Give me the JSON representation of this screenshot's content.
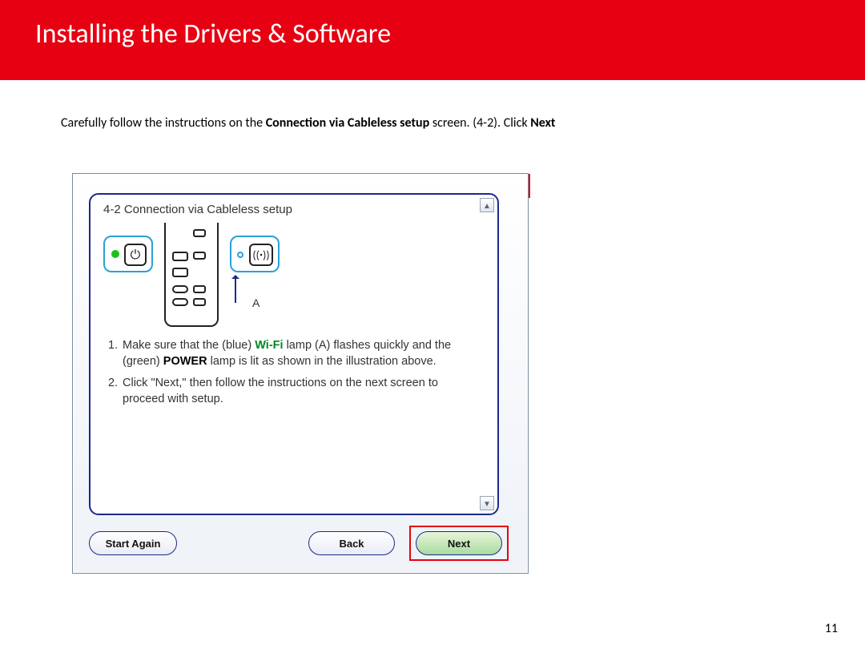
{
  "banner": {
    "title": "Installing  the Drivers & Software"
  },
  "intro": {
    "pre": "Carefully follow the instructions on the ",
    "bold1": "Connection via Cableless setup",
    "mid": " screen. (4-2).  Click ",
    "bold2": "Next"
  },
  "wizard": {
    "title": "4-2 Connection via Cableless setup",
    "illus": {
      "a_label": "A"
    },
    "steps": [
      {
        "num": "1.",
        "pre": "Make sure that the (blue) ",
        "wifi": "Wi-Fi",
        "mid1": " lamp (A) flashes quickly and the (green) ",
        "power": "POWER",
        "post": " lamp is lit as shown in the illustration above."
      },
      {
        "num": "2.",
        "text": "Click \"Next,\" then follow the instructions on the next screen to proceed with setup."
      }
    ],
    "buttons": {
      "start_again": "Start Again",
      "back": "Back",
      "next": "Next"
    }
  },
  "page_number": "11"
}
